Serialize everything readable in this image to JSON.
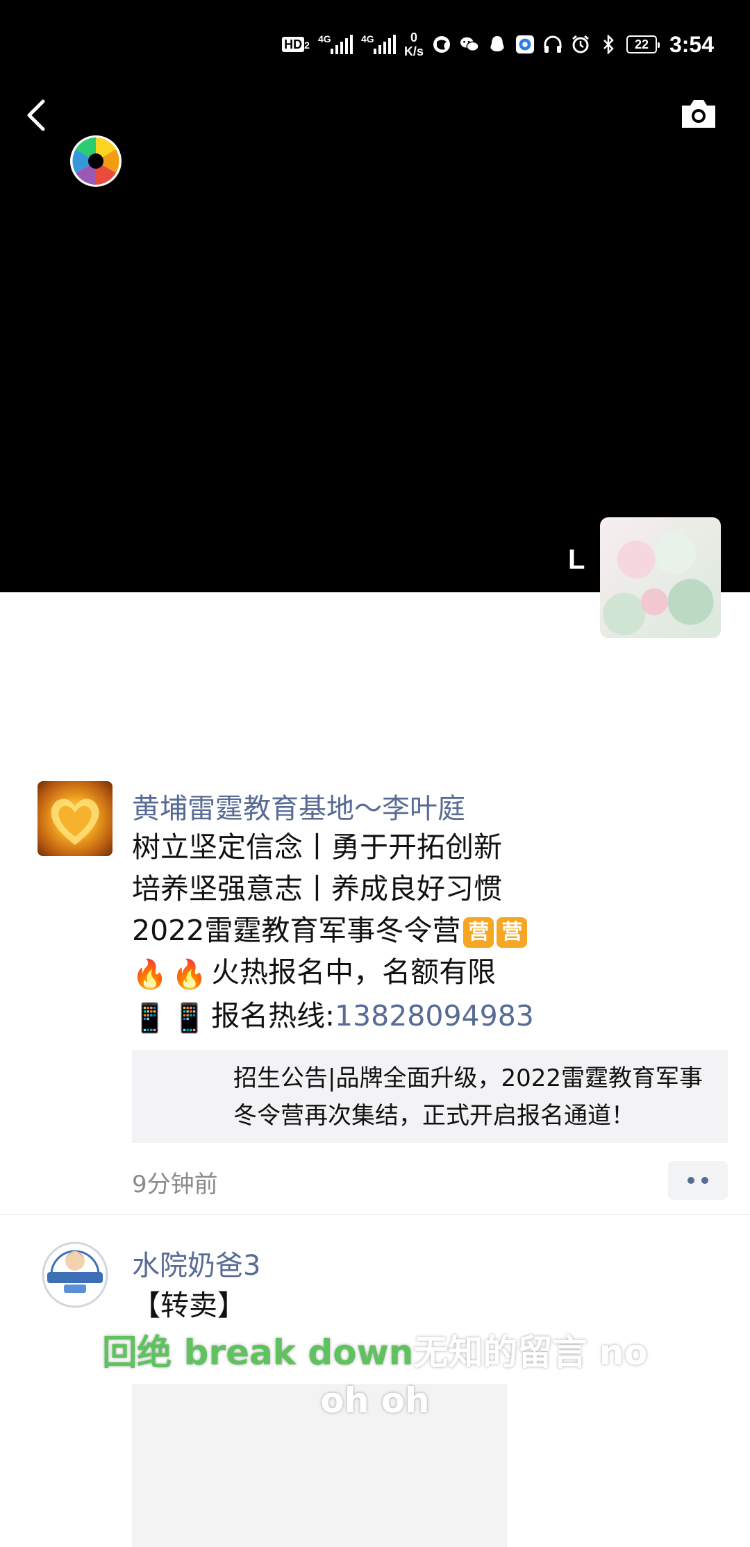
{
  "status_bar": {
    "hd_label": "HD",
    "hd_sub": "2",
    "net_gen_1": "4G",
    "net_gen_2": "4G",
    "net_speed_value": "0",
    "net_speed_unit": "K/s",
    "battery": "22",
    "time": "3:54"
  },
  "cover": {
    "username": "L"
  },
  "posts": [
    {
      "author": "黄埔雷霆教育基地～李叶庭",
      "lines": [
        "树立坚定信念丨勇于开拓创新",
        "培养坚强意志丨养成良好习惯",
        "2022雷霆教育军事冬令营"
      ],
      "camp_badge": "营",
      "fire_emoji": "🔥",
      "phone_emoji": "📱",
      "line4_text": "火热报名中，名额有限",
      "hotline_label": "报名热线:",
      "hotline_number": "13828094983",
      "link_text": "招生公告|品牌全面升级，2022雷霆教育军事冬令营再次集结，正式开启报名通道！",
      "time": "9分钟前"
    },
    {
      "author": "水院奶爸3",
      "title": "【转卖】"
    }
  ],
  "subtitle": {
    "line1_green": "回绝 break down",
    "line1_white": "无知的留言 no",
    "line2": "oh oh"
  },
  "colors": {
    "link_blue": "#576b95",
    "subtitle_green": "#5fc25f"
  }
}
